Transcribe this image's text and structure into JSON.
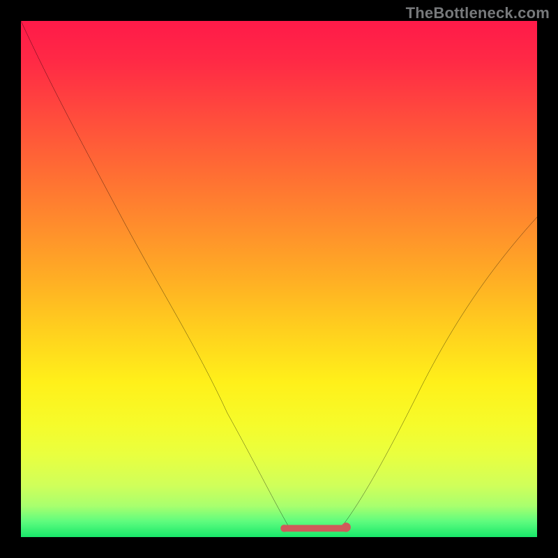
{
  "watermark": "TheBottleneck.com",
  "chart_data": {
    "type": "line",
    "title": "",
    "xlabel": "",
    "ylabel": "",
    "xlim": [
      0,
      100
    ],
    "ylim": [
      0,
      100
    ],
    "x": [
      0,
      5,
      10,
      15,
      20,
      25,
      30,
      35,
      40,
      45,
      50,
      52,
      55,
      58,
      60,
      62,
      65,
      70,
      75,
      80,
      85,
      90,
      95,
      100
    ],
    "values": [
      100,
      89,
      80,
      70,
      61,
      52,
      42,
      33,
      24,
      15,
      6,
      2,
      0,
      0,
      0,
      2,
      6,
      14,
      23,
      32,
      41,
      49,
      56,
      62
    ],
    "trough": {
      "x_range": [
        52,
        62
      ],
      "value": 0
    },
    "trough_marker": {
      "active": true,
      "type": "flat-band",
      "color": "#cf5a5a",
      "thickness_px": 8
    },
    "gradient_colors_top_to_bottom": [
      "#ff1a49",
      "#ff6f33",
      "#ffae24",
      "#fff01a",
      "#d0ff5a",
      "#18e86a"
    ],
    "grid": false,
    "legend": false
  }
}
